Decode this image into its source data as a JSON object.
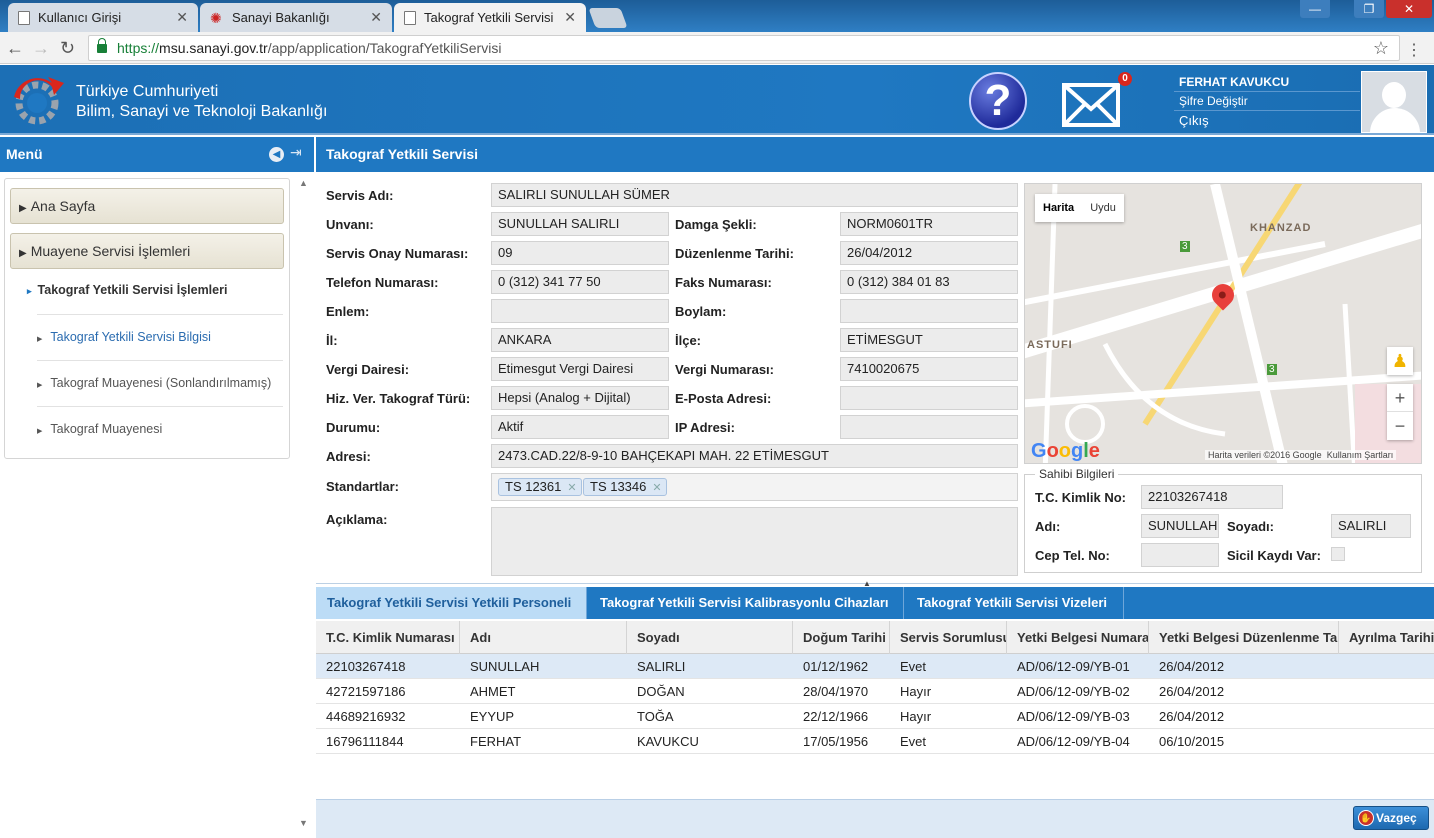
{
  "browser": {
    "tabs": [
      {
        "title": "Kullanıcı Girişi",
        "close": "✕"
      },
      {
        "title": "Sanayi Bakanlığı",
        "close": "✕"
      },
      {
        "title": "Takograf Yetkili Servisi Bi",
        "close": "✕"
      }
    ],
    "url_scheme": "https://",
    "url_host": "msu.sanayi.gov.tr",
    "url_path": "/app/application/TakografYetkiliServisi",
    "window_controls": {
      "minimize": "—",
      "maximize": "❐",
      "close": "✕"
    }
  },
  "header": {
    "org_line1": "Türkiye Cumhuriyeti",
    "org_line2": "Bilim, Sanayi ve Teknoloji Bakanlığı",
    "help_icon": "question-icon",
    "mail_count": "0",
    "user_name": "FERHAT KAVUKCU",
    "change_password": "Şifre Değiştir",
    "logout": "Çıkış"
  },
  "sidebar": {
    "title": "Menü",
    "items": [
      {
        "label": "Ana Sayfa"
      },
      {
        "label": "Muayene Servisi İşlemleri"
      }
    ],
    "section_title": "Takograf Yetkili Servisi İşlemleri",
    "subitems": [
      {
        "label": "Takograf Yetkili Servisi Bilgisi"
      },
      {
        "label": "Takograf Muayenesi (Sonlandırılmamış)"
      },
      {
        "label": "Takograf Muayenesi"
      }
    ]
  },
  "page": {
    "title": "Takograf Yetkili Servisi"
  },
  "form": {
    "servis_adi": {
      "label": "Servis Adı:",
      "value": "SALIRLI SUNULLAH SÜMER"
    },
    "unvani": {
      "label": "Unvanı:",
      "value": "SUNULLAH SALIRLI"
    },
    "damga_sekli": {
      "label": "Damga Şekli:",
      "value": "NORM0601TR"
    },
    "onay_no": {
      "label": "Servis Onay Numarası:",
      "value": "09"
    },
    "duzenlenme": {
      "label": "Düzenlenme Tarihi:",
      "value": "26/04/2012"
    },
    "telefon": {
      "label": "Telefon Numarası:",
      "value": "0 (312) 341 77 50"
    },
    "faks": {
      "label": "Faks Numarası:",
      "value": "0 (312) 384 01 83"
    },
    "enlem": {
      "label": "Enlem:",
      "value": ""
    },
    "boylam": {
      "label": "Boylam:",
      "value": ""
    },
    "il": {
      "label": "İl:",
      "value": "ANKARA"
    },
    "ilce": {
      "label": "İlçe:",
      "value": "ETİMESGUT"
    },
    "vergi_dairesi": {
      "label": "Vergi Dairesi:",
      "value": "Etimesgut Vergi Dairesi"
    },
    "vergi_no": {
      "label": "Vergi Numarası:",
      "value": "7410020675"
    },
    "takograf_turu": {
      "label": "Hiz. Ver. Takograf Türü:",
      "value": "Hepsi (Analog + Dijital)"
    },
    "eposta": {
      "label": "E-Posta Adresi:",
      "value": ""
    },
    "durumu": {
      "label": "Durumu:",
      "value": "Aktif"
    },
    "ip": {
      "label": "IP Adresi:",
      "value": ""
    },
    "adres": {
      "label": "Adresi:",
      "value": "2473.CAD.22/8-9-10 BAHÇEKAPI MAH. 22   ETİMESGUT"
    },
    "standartlar": {
      "label": "Standartlar:",
      "tags": [
        "TS 12361",
        "TS 13346"
      ]
    },
    "aciklama": {
      "label": "Açıklama:",
      "value": ""
    }
  },
  "map": {
    "tab_map": "Harita",
    "tab_satellite": "Uydu",
    "district1": "KHANZAD",
    "district2": "ASTUFI",
    "route_badge": "3",
    "logo": "Google",
    "attribution": "Harita verileri ©2016 Google",
    "terms": "Kullanım Şartları",
    "zoom_in": "+",
    "zoom_out": "−"
  },
  "owner": {
    "legend": "Sahibi Bilgileri",
    "tc_label": "T.C. Kimlik No:",
    "tc_value": "22103267418",
    "adi_label": "Adı:",
    "adi_value": "SUNULLAH",
    "soyadi_label": "Soyadı:",
    "soyadi_value": "SALIRLI",
    "cep_label": "Cep Tel. No:",
    "cep_value": "",
    "sicil_label": "Sicil Kaydı Var:"
  },
  "lower_tabs": [
    {
      "label": "Takograf Yetkili Servisi Yetkili Personeli"
    },
    {
      "label": "Takograf Yetkili Servisi Kalibrasyonlu Cihazları"
    },
    {
      "label": "Takograf Yetkili Servisi Vizeleri"
    }
  ],
  "grid": {
    "columns": [
      "T.C. Kimlik Numarası",
      "Adı",
      "Soyadı",
      "Doğum Tarihi",
      "Servis Sorumlusu",
      "Yetki Belgesi Numarası",
      "Yetki Belgesi Düzenlenme Tarihi",
      "Ayrılma Tarihi"
    ],
    "rows": [
      [
        "22103267418",
        "SUNULLAH",
        "SALIRLI",
        "01/12/1962",
        "Evet",
        "AD/06/12-09/YB-01",
        "26/04/2012",
        ""
      ],
      [
        "42721597186",
        "AHMET",
        "DOĞAN",
        "28/04/1970",
        "Hayır",
        "AD/06/12-09/YB-02",
        "26/04/2012",
        ""
      ],
      [
        "44689216932",
        "EYYUP",
        "TOĞA",
        "22/12/1966",
        "Hayır",
        "AD/06/12-09/YB-03",
        "26/04/2012",
        ""
      ],
      [
        "16796111844",
        "FERHAT",
        "KAVUKCU",
        "17/05/1956",
        "Evet",
        "AD/06/12-09/YB-04",
        "06/10/2015",
        ""
      ]
    ]
  },
  "footer": {
    "cancel_label": "Vazgeç"
  },
  "colors": {
    "brand_blue": "#1f78c2",
    "accent_red": "#d9261c"
  }
}
